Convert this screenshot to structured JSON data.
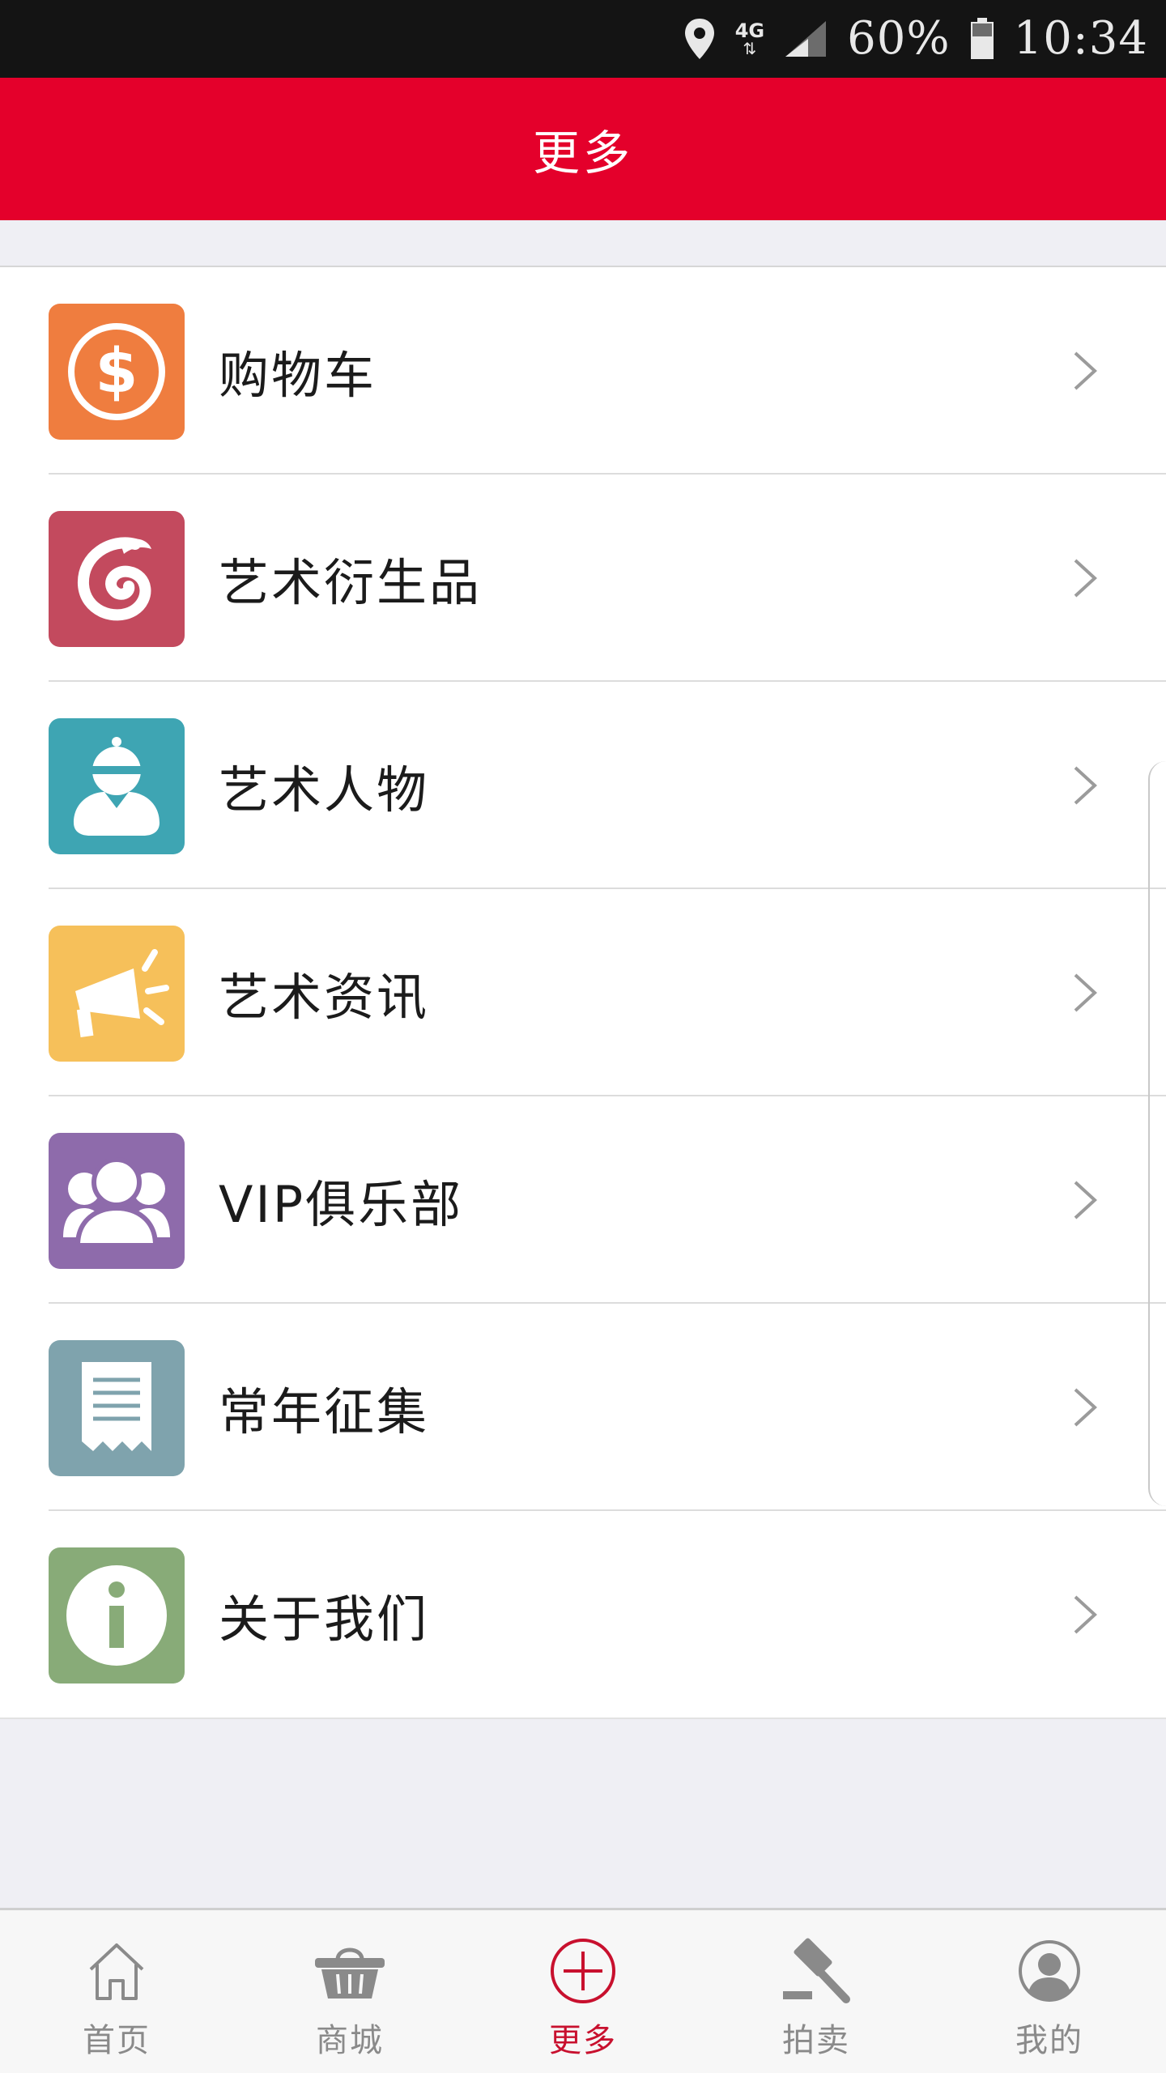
{
  "status_bar": {
    "network": "4G",
    "battery": "60%",
    "time": "10:34"
  },
  "header": {
    "title": "更多"
  },
  "menu": {
    "items": [
      {
        "label": "购物车",
        "icon": "dollar-coin-icon",
        "color": "#ef7d3f"
      },
      {
        "label": "艺术衍生品",
        "icon": "swirl-logo-icon",
        "color": "#c34a5e"
      },
      {
        "label": "艺术人物",
        "icon": "person-icon",
        "color": "#3ea5b3"
      },
      {
        "label": "艺术资讯",
        "icon": "megaphone-icon",
        "color": "#f6c05a"
      },
      {
        "label": "VIP俱乐部",
        "icon": "group-icon",
        "color": "#8e6bab"
      },
      {
        "label": "常年征集",
        "icon": "receipt-icon",
        "color": "#7fa3ad"
      },
      {
        "label": "关于我们",
        "icon": "info-icon",
        "color": "#88ab78"
      }
    ]
  },
  "tab_bar": {
    "active_color": "#c8102e",
    "tabs": [
      {
        "label": "首页",
        "icon": "home-icon",
        "active": false
      },
      {
        "label": "商城",
        "icon": "basket-icon",
        "active": false
      },
      {
        "label": "更多",
        "icon": "plus-circle-icon",
        "active": true
      },
      {
        "label": "拍卖",
        "icon": "gavel-icon",
        "active": false
      },
      {
        "label": "我的",
        "icon": "user-icon",
        "active": false
      }
    ]
  }
}
